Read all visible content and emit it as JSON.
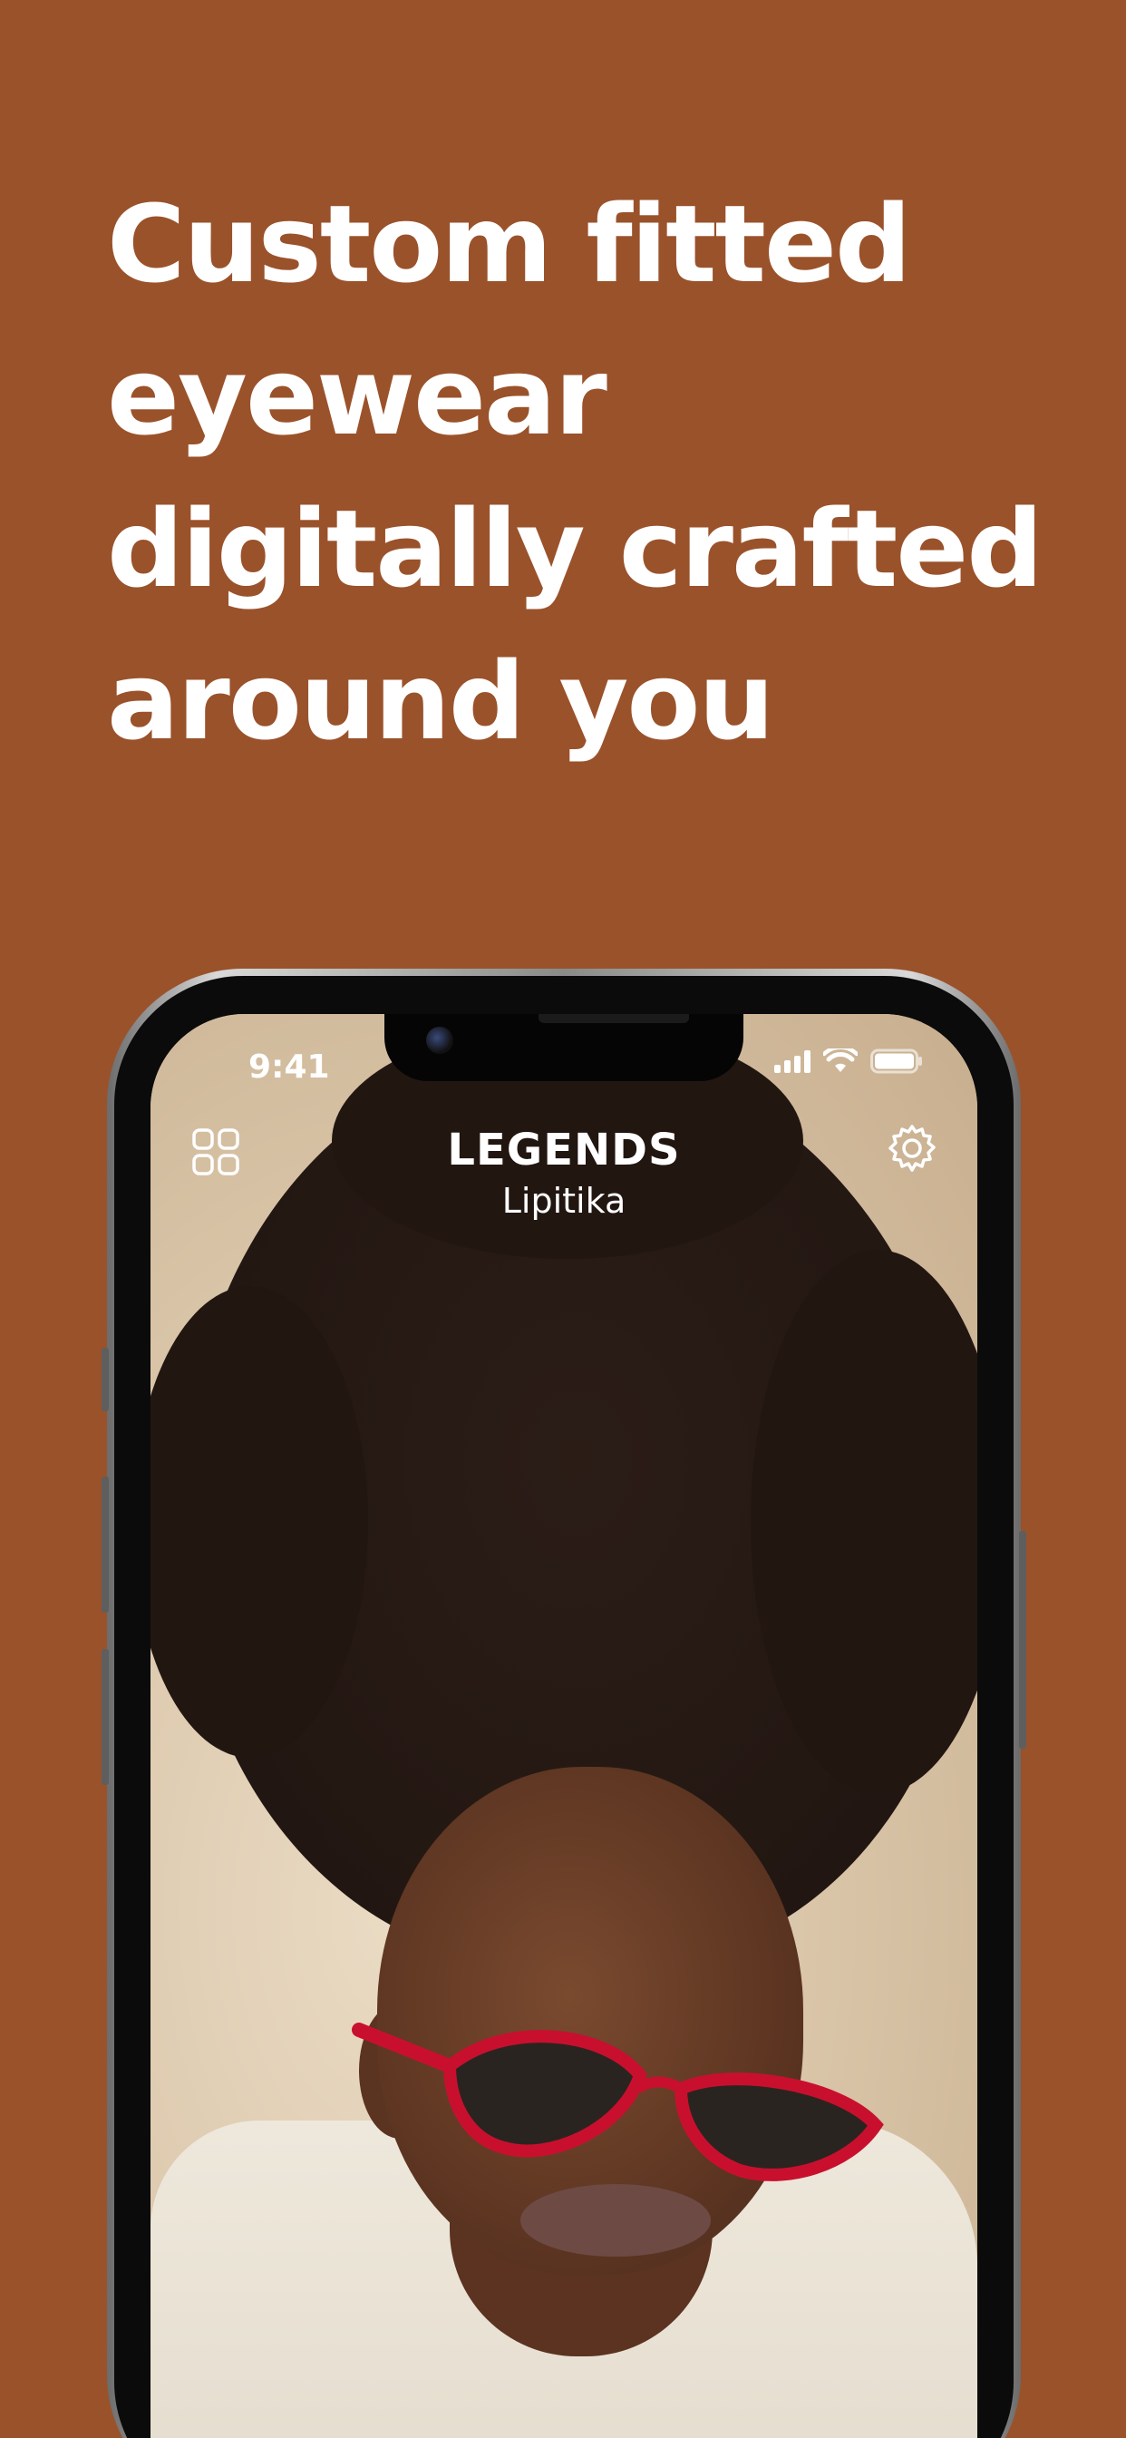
{
  "headline": {
    "lines": [
      "Custom fitted",
      "eyewear",
      "digitally crafted",
      "around you"
    ]
  },
  "status_bar": {
    "time": "9:41",
    "icons": [
      "signal-icon",
      "wifi-icon",
      "battery-icon"
    ]
  },
  "app_header": {
    "title": "LEGENDS",
    "subtitle": "Lipitika",
    "left_icon": "grid-icon",
    "right_icon": "gear-icon"
  },
  "colors": {
    "background": "#9a522b",
    "headline_text": "#ffffff",
    "frame_red": "#c8102e",
    "lens_tint": "#2a2420"
  }
}
